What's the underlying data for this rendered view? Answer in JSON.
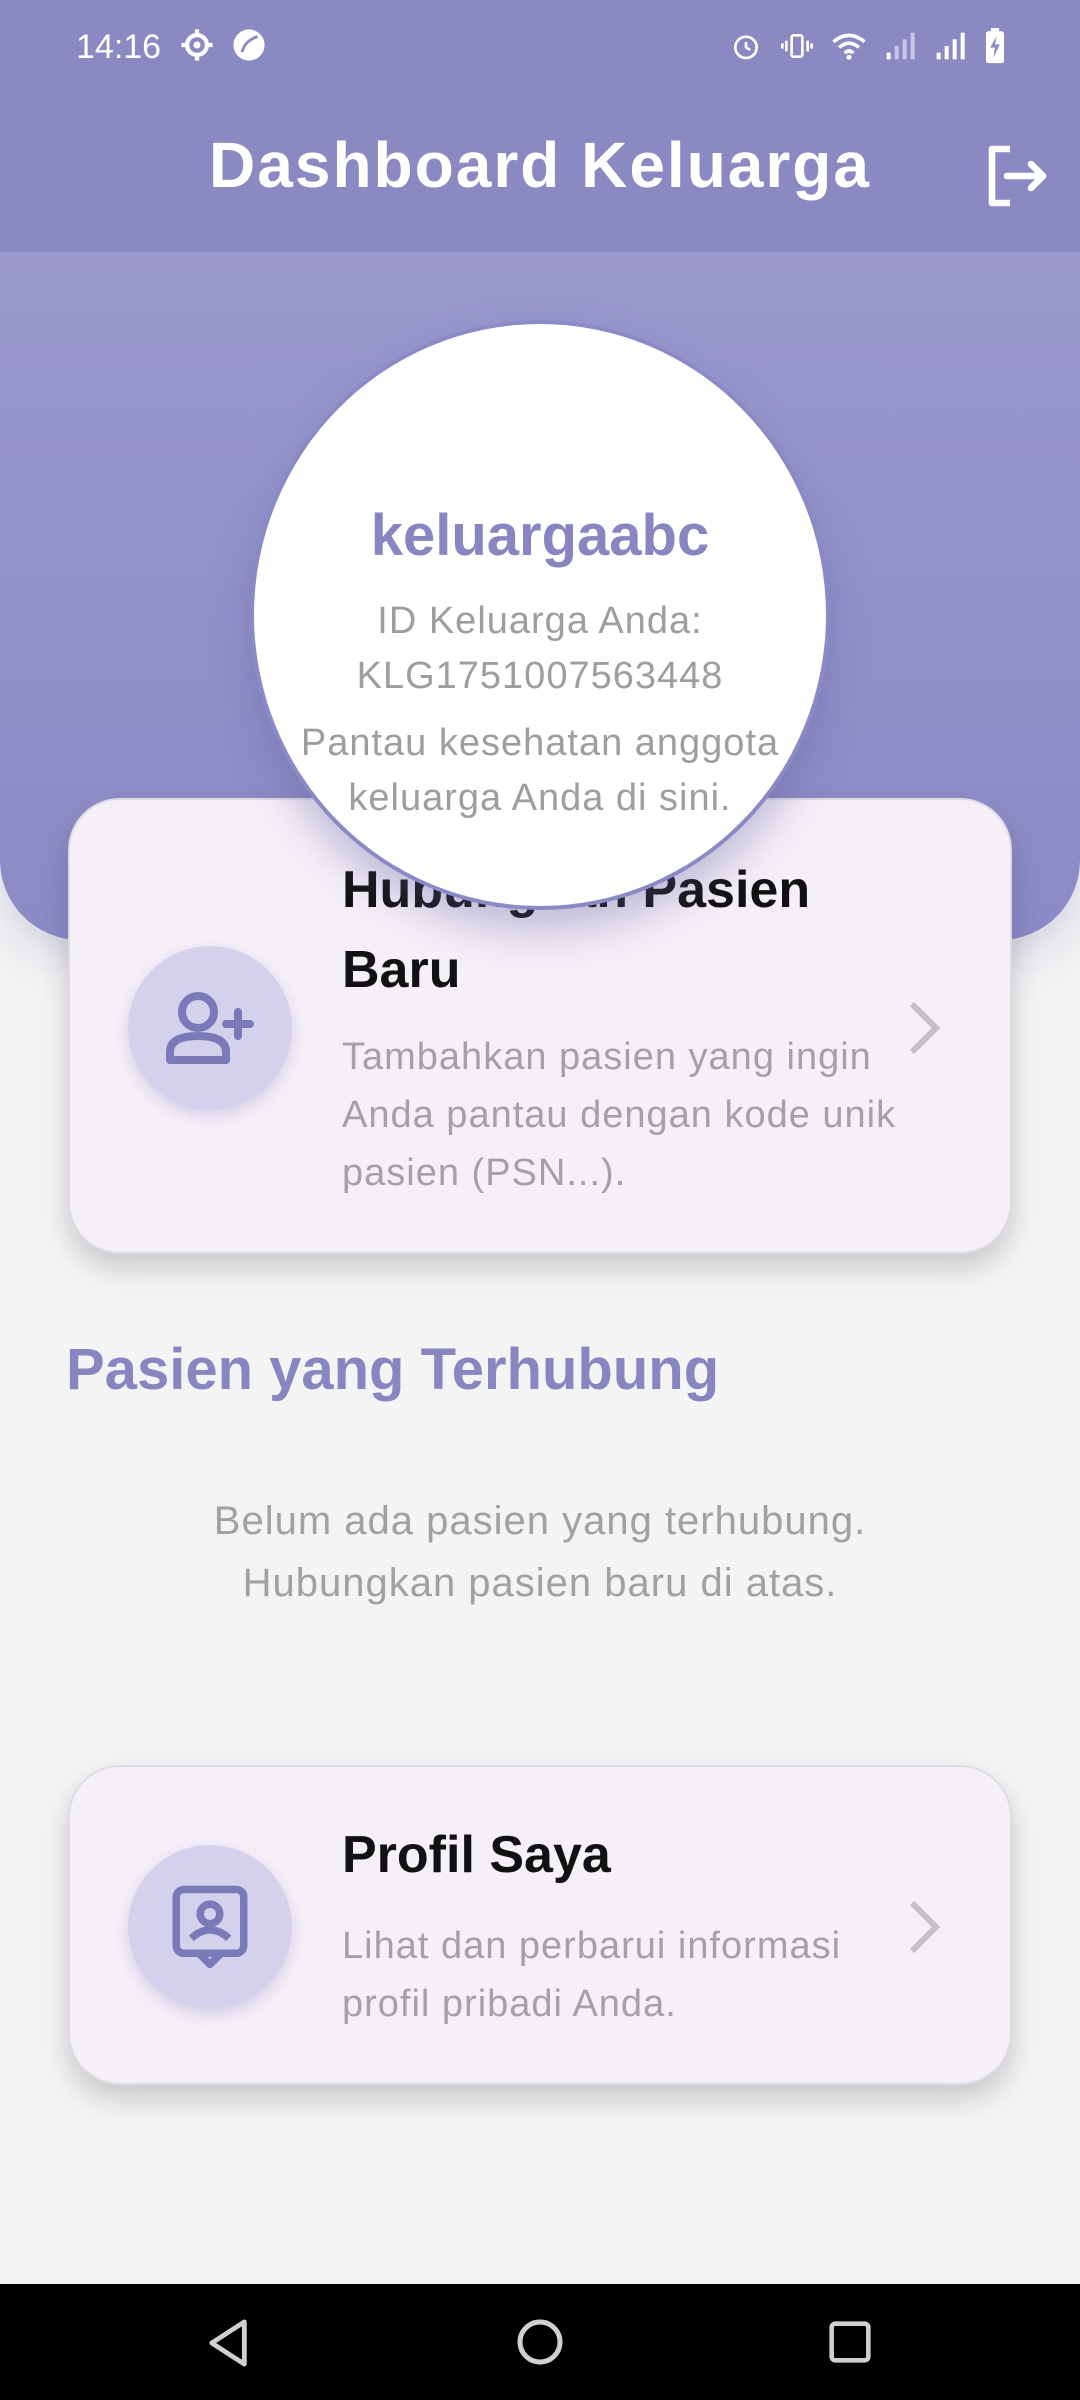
{
  "status_bar": {
    "time": "14:16",
    "left_icons": [
      "settings-icon",
      "leaf-icon"
    ],
    "right_icons": [
      "alarm-icon",
      "vibrate-icon",
      "wifi-icon",
      "signal-weak-icon",
      "signal-icon",
      "battery-charging-icon"
    ]
  },
  "app_bar": {
    "title": "Dashboard Keluarga",
    "logout_icon": "logout-icon"
  },
  "profile": {
    "username": "keluargaabc",
    "id_label": "ID Keluarga Anda:",
    "id_value": "KLG1751007563448",
    "description": "Pantau kesehatan anggota keluarga Anda di sini."
  },
  "connect_card": {
    "icon": "add-user-icon",
    "title": "Hubungkan Pasien Baru",
    "description": "Tambahkan pasien yang ingin Anda pantau dengan kode unik pasien (PSN...)."
  },
  "connected_section": {
    "title": "Pasien yang Terhubung",
    "empty_line1": "Belum ada pasien yang terhubung.",
    "empty_line2": "Hubungkan pasien baru di atas."
  },
  "profile_card": {
    "icon": "profile-badge-icon",
    "title": "Profil Saya",
    "description": "Lihat dan perbarui informasi profil pribadi Anda."
  },
  "nav_bar": {
    "buttons": [
      "back-icon",
      "home-icon",
      "recents-icon"
    ]
  },
  "colors": {
    "primary": "#8a89c2",
    "accent_text": "#8786c0",
    "card_bg": "#f5eff8",
    "icon_circle": "#d3d1ec",
    "background": "#f4f4f5"
  }
}
